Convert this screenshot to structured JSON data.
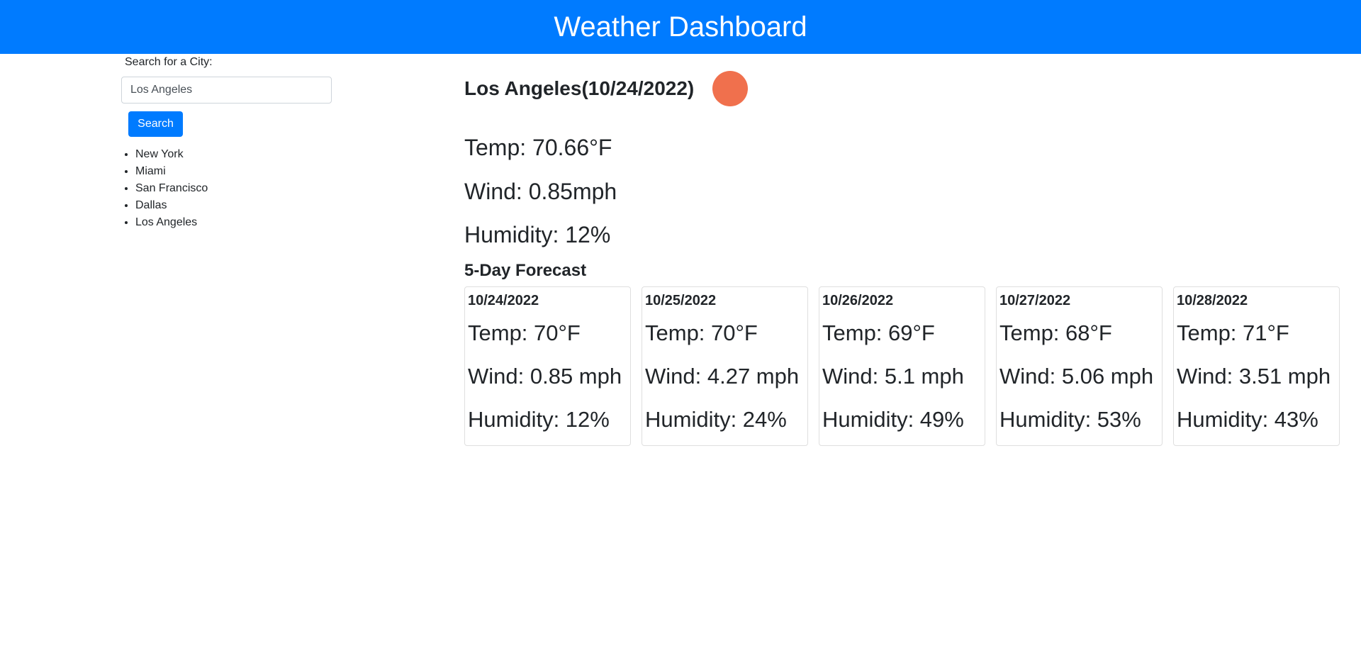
{
  "header": {
    "title": "Weather Dashboard"
  },
  "search": {
    "label": "Search for a City:",
    "value": "Los Angeles",
    "button_label": "Search"
  },
  "history": [
    "New York",
    "Miami",
    "San Francisco",
    "Dallas",
    "Los Angeles"
  ],
  "current": {
    "title": "Los Angeles(10/24/2022)",
    "icon": "weather-condition-icon",
    "icon_color": "#f0704d",
    "temp": "Temp: 70.66°F",
    "wind": "Wind: 0.85mph",
    "humidity": "Humidity: 12%"
  },
  "forecast": {
    "heading": "5-Day Forecast",
    "days": [
      {
        "date": "10/24/2022",
        "temp": "Temp: 70°F",
        "wind": "Wind: 0.85 mph",
        "humidity": "Humidity: 12%"
      },
      {
        "date": "10/25/2022",
        "temp": "Temp: 70°F",
        "wind": "Wind: 4.27 mph",
        "humidity": "Humidity: 24%"
      },
      {
        "date": "10/26/2022",
        "temp": "Temp: 69°F",
        "wind": "Wind: 5.1 mph",
        "humidity": "Humidity: 49%"
      },
      {
        "date": "10/27/2022",
        "temp": "Temp: 68°F",
        "wind": "Wind: 5.06 mph",
        "humidity": "Humidity: 53%"
      },
      {
        "date": "10/28/2022",
        "temp": "Temp: 71°F",
        "wind": "Wind: 3.51 mph",
        "humidity": "Humidity: 43%"
      }
    ]
  },
  "colors": {
    "header_bg": "#007bff",
    "button_bg": "#007bff"
  }
}
